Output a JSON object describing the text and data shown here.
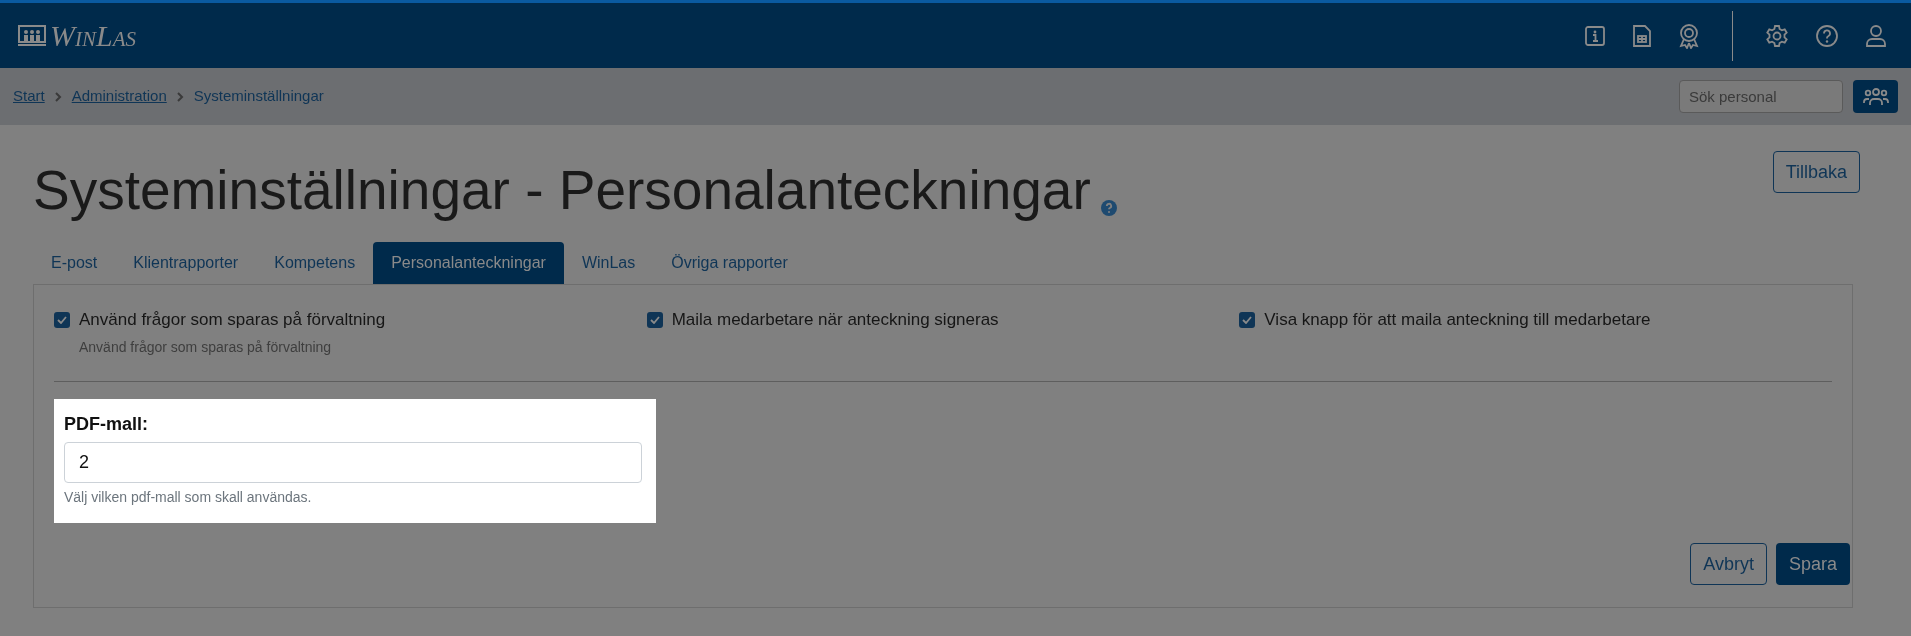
{
  "header": {
    "logo": "WinLas",
    "icons": [
      {
        "kind": "info"
      },
      {
        "kind": "sheet"
      },
      {
        "kind": "award"
      },
      {
        "kind": "divider"
      },
      {
        "kind": "settings"
      },
      {
        "kind": "help"
      },
      {
        "kind": "user"
      }
    ]
  },
  "breadcrumb": [
    {
      "label": "Start",
      "link": true
    },
    {
      "label": "Administration",
      "link": true
    },
    {
      "label": "Systeminställningar",
      "link": false
    }
  ],
  "search": {
    "placeholder": "Sök personal"
  },
  "page": {
    "title": "Systeminställningar - Personalanteckningar",
    "back_button": "Tillbaka"
  },
  "tabs": [
    {
      "label": "E-post",
      "selected": false
    },
    {
      "label": "Klientrapporter",
      "selected": false
    },
    {
      "label": "Kompetens",
      "selected": false
    },
    {
      "label": "Personalanteckningar",
      "selected": true
    },
    {
      "label": "WinLas",
      "selected": false
    },
    {
      "label": "Övriga rapporter",
      "selected": false
    }
  ],
  "options": [
    {
      "label": "Använd frågor som sparas på förvaltning",
      "hint": "Använd frågor som sparas på förvaltning",
      "checked": true
    },
    {
      "label": "Maila medarbetare när anteckning signeras",
      "checked": true
    },
    {
      "label": "Visa knapp för att maila anteckning till medarbetare",
      "checked": true
    }
  ],
  "pdf_field": {
    "label": "PDF-mall:",
    "value": "2",
    "help": "Välj vilken pdf-mall som skall användas."
  },
  "buttons": [
    "Avbryt",
    "Spara"
  ]
}
